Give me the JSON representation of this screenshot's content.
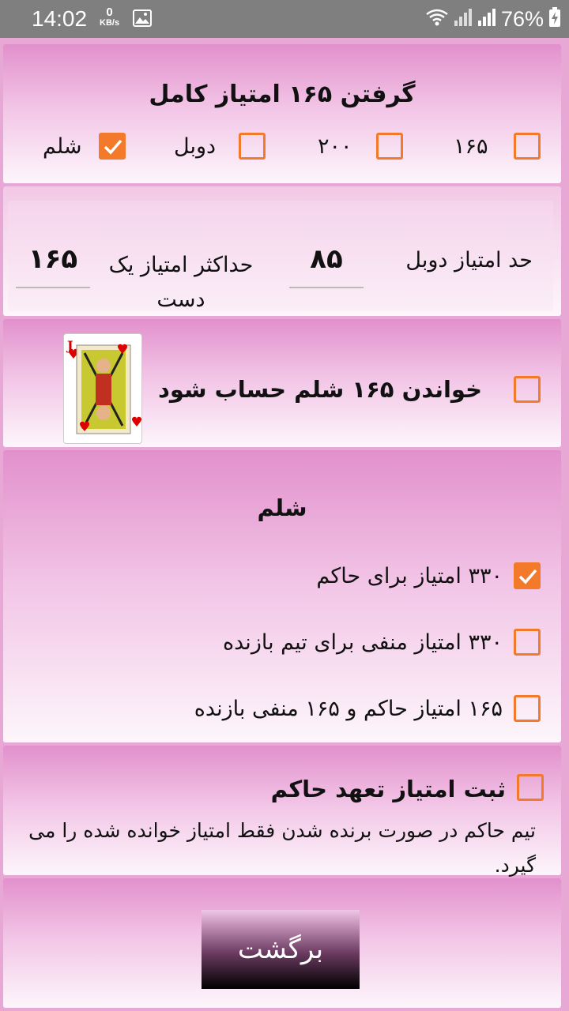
{
  "status": {
    "time": "14:02",
    "net_speed_value": "0",
    "net_speed_unit": "KB/s",
    "battery": "76%"
  },
  "full_score": {
    "title": "گرفتن ۱۶۵ امتیاز کامل",
    "options": [
      {
        "label": "۱۶۵",
        "checked": false
      },
      {
        "label": "۲۰۰",
        "checked": false
      },
      {
        "label": "دوبل",
        "checked": false
      },
      {
        "label": "شلم",
        "checked": true
      }
    ]
  },
  "limits": {
    "double_label": "حد امتیاز دوبل",
    "double_value": "۸۵",
    "max_label": "حداکثر امتیاز یک دست",
    "max_value": "۱۶۵"
  },
  "call_slam": {
    "label": "خواندن ۱۶۵ شلم حساب شود",
    "checked": false
  },
  "slam": {
    "title": "شلم",
    "options": [
      {
        "label": "۳۳۰ امتیاز برای حاکم",
        "checked": true
      },
      {
        "label": "۳۳۰ امتیاز منفی برای تیم بازنده",
        "checked": false
      },
      {
        "label": "۱۶۵ امتیاز حاکم و ۱۶۵ منفی بازنده",
        "checked": false
      }
    ]
  },
  "commitment": {
    "title": "ثبت امتیاز تعهد حاکم",
    "checked": false,
    "description": "تیم حاکم در صورت برنده شدن فقط امتیاز خوانده شده را می گیرد."
  },
  "back_button": "برگشت",
  "colors": {
    "accent": "#f27a2a",
    "panel_top": "#e290cc",
    "panel_bottom": "#fdf6fb"
  }
}
